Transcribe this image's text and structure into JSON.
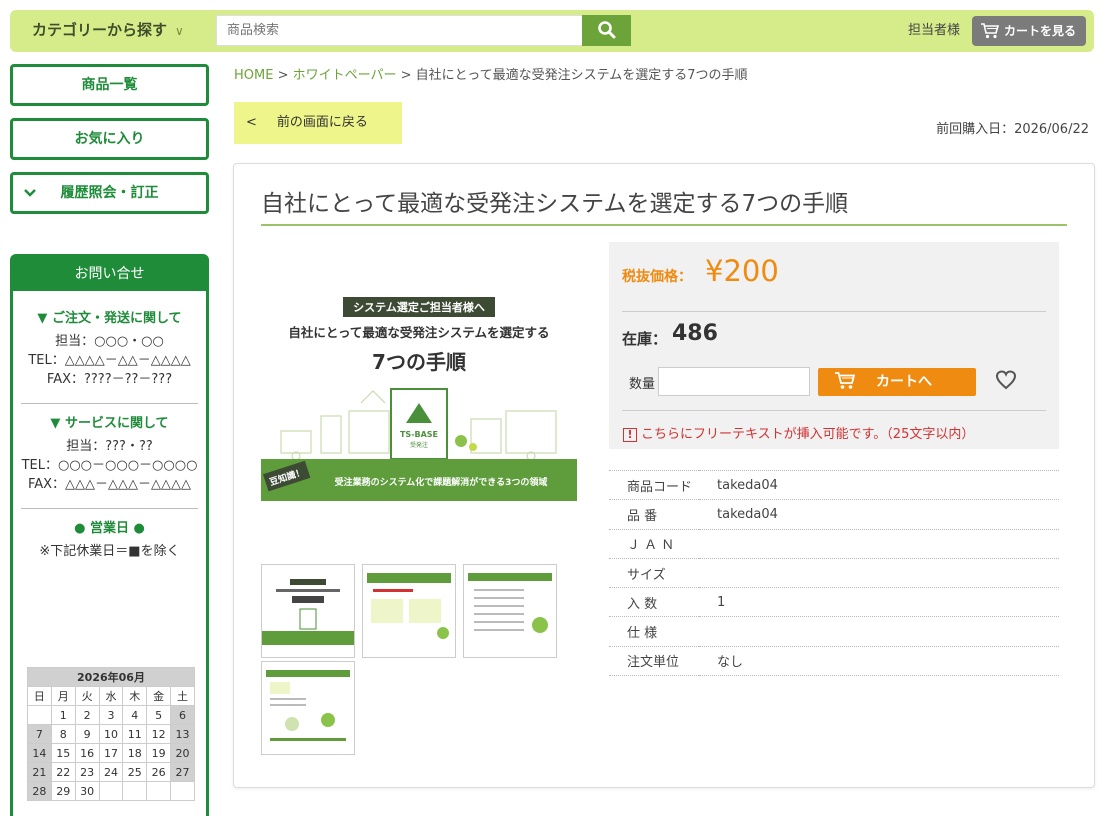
{
  "header": {
    "category_label": "カテゴリーから探す",
    "category_chevron": "∨",
    "search_placeholder": "商品検索",
    "user_name": "担当者様",
    "cart_label": "カートを見る"
  },
  "sidebar": {
    "items": [
      {
        "label": "商品一覧"
      },
      {
        "label": "お気に入り"
      },
      {
        "label": "履歴照会・訂正"
      }
    ],
    "contact": {
      "title": "お問い合せ",
      "order": {
        "title": "▼ ご注文・発送に関して",
        "person": "担当：○○○・○○",
        "tel": "TEL：△△△△－△△－△△△△",
        "fax": "FAX：????－??－???"
      },
      "service": {
        "title": "▼ サービスに関して",
        "person": "担当：???・??",
        "tel": "TEL：○○○－○○○－○○○○",
        "fax": "FAX：△△△－△△△－△△△△"
      },
      "business_days": {
        "title": "● 営業日 ●",
        "note": "※下記休業日＝■を除く"
      }
    },
    "calendar": {
      "title": "2026年06月",
      "weekdays": [
        "日",
        "月",
        "火",
        "水",
        "木",
        "金",
        "土"
      ],
      "rows": [
        [
          "",
          "1",
          "2",
          "3",
          "4",
          "5",
          "6"
        ],
        [
          "7",
          "8",
          "9",
          "10",
          "11",
          "12",
          "13"
        ],
        [
          "14",
          "15",
          "16",
          "17",
          "18",
          "19",
          "20"
        ],
        [
          "21",
          "22",
          "23",
          "24",
          "25",
          "26",
          "27"
        ],
        [
          "28",
          "29",
          "30",
          "",
          "",
          "",
          ""
        ]
      ],
      "holidays": [
        "6",
        "7",
        "13",
        "14",
        "20",
        "21",
        "27",
        "28"
      ]
    }
  },
  "breadcrumb": {
    "home": "HOME",
    "sep1": " > ",
    "category": "ホワイトペーパー",
    "sep2": " > ",
    "current": "自社にとって最適な受発注システムを選定する7つの手順"
  },
  "back_button": {
    "icon": "<",
    "label": "前の画面に戻る"
  },
  "last_purchase": "前回購入日：2026/06/22",
  "product": {
    "title": "自社にとって最適な受発注システムを選定する7つの手順",
    "image": {
      "banner": "システム選定ご担当者様へ",
      "headline": "自社にとって最適な受発注システムを選定する",
      "big_text": "7つの手順",
      "logo_text": "TS-BASE",
      "logo_sub": "受発注",
      "badge": "豆知識！",
      "footer": "受注業務のシステム化で課題解消ができる",
      "footer_num": "3",
      "footer_end": "つの領域"
    },
    "price_label": "税抜価格：",
    "price": "¥200",
    "stock_label": "在庫：",
    "stock": "486",
    "qty_label": "数量",
    "add_to_cart": "カートへ",
    "free_text": "こちらにフリーテキストが挿入可能です。（25文字以内）",
    "free_text_icon": "!",
    "specs": [
      {
        "key": "商品コード",
        "value": "takeda04"
      },
      {
        "key": "品 番",
        "value": "takeda04"
      },
      {
        "key": "Ｊ Ａ Ｎ",
        "value": ""
      },
      {
        "key": "サイズ",
        "value": ""
      },
      {
        "key": "入 数",
        "value": "1"
      },
      {
        "key": "仕 様",
        "value": ""
      },
      {
        "key": "注文単位",
        "value": "なし"
      }
    ]
  },
  "colors": {
    "accent_green": "#1f8c3a",
    "header_lime": "#d6ec8a",
    "price_orange": "#f08b12",
    "alert_red": "#d23232"
  }
}
